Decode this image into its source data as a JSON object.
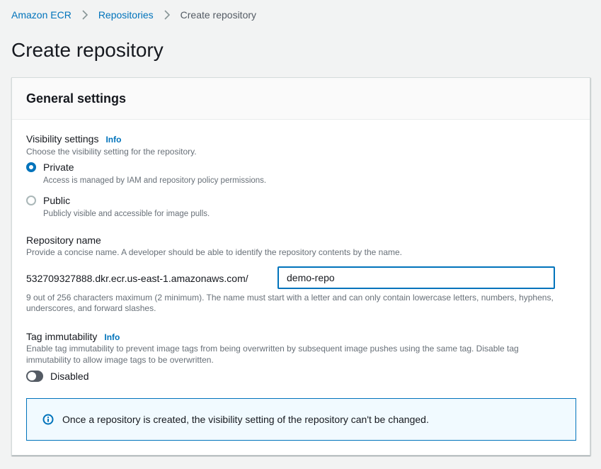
{
  "breadcrumb": {
    "items": [
      {
        "label": "Amazon ECR"
      },
      {
        "label": "Repositories"
      },
      {
        "label": "Create repository"
      }
    ]
  },
  "page": {
    "title": "Create repository"
  },
  "general_settings": {
    "title": "General settings",
    "visibility": {
      "label": "Visibility settings",
      "info": "Info",
      "description": "Choose the visibility setting for the repository.",
      "selected": "Private",
      "options": [
        {
          "label": "Private",
          "description": "Access is managed by IAM and repository policy permissions."
        },
        {
          "label": "Public",
          "description": "Publicly visible and accessible for image pulls."
        }
      ]
    },
    "repository_name": {
      "label": "Repository name",
      "description": "Provide a concise name. A developer should be able to identify the repository contents by the name.",
      "prefix": "532709327888.dkr.ecr.us-east-1.amazonaws.com/",
      "value": "demo-repo",
      "constraint": "9 out of 256 characters maximum (2 minimum). The name must start with a letter and can only contain lowercase letters, numbers, hyphens, underscores, and forward slashes."
    },
    "tag_immutability": {
      "label": "Tag immutability",
      "info": "Info",
      "description": "Enable tag immutability to prevent image tags from being overwritten by subsequent image pushes using the same tag. Disable tag immutability to allow image tags to be overwritten.",
      "toggle_label": "Disabled",
      "enabled": false
    },
    "alert": {
      "icon": "info-circle-icon",
      "text": "Once a repository is created, the visibility setting of the repository can't be changed."
    }
  },
  "colors": {
    "link": "#0073bb",
    "alert_border": "#0073bb",
    "alert_background": "#f1faff",
    "toggle_off": "#545b64"
  }
}
